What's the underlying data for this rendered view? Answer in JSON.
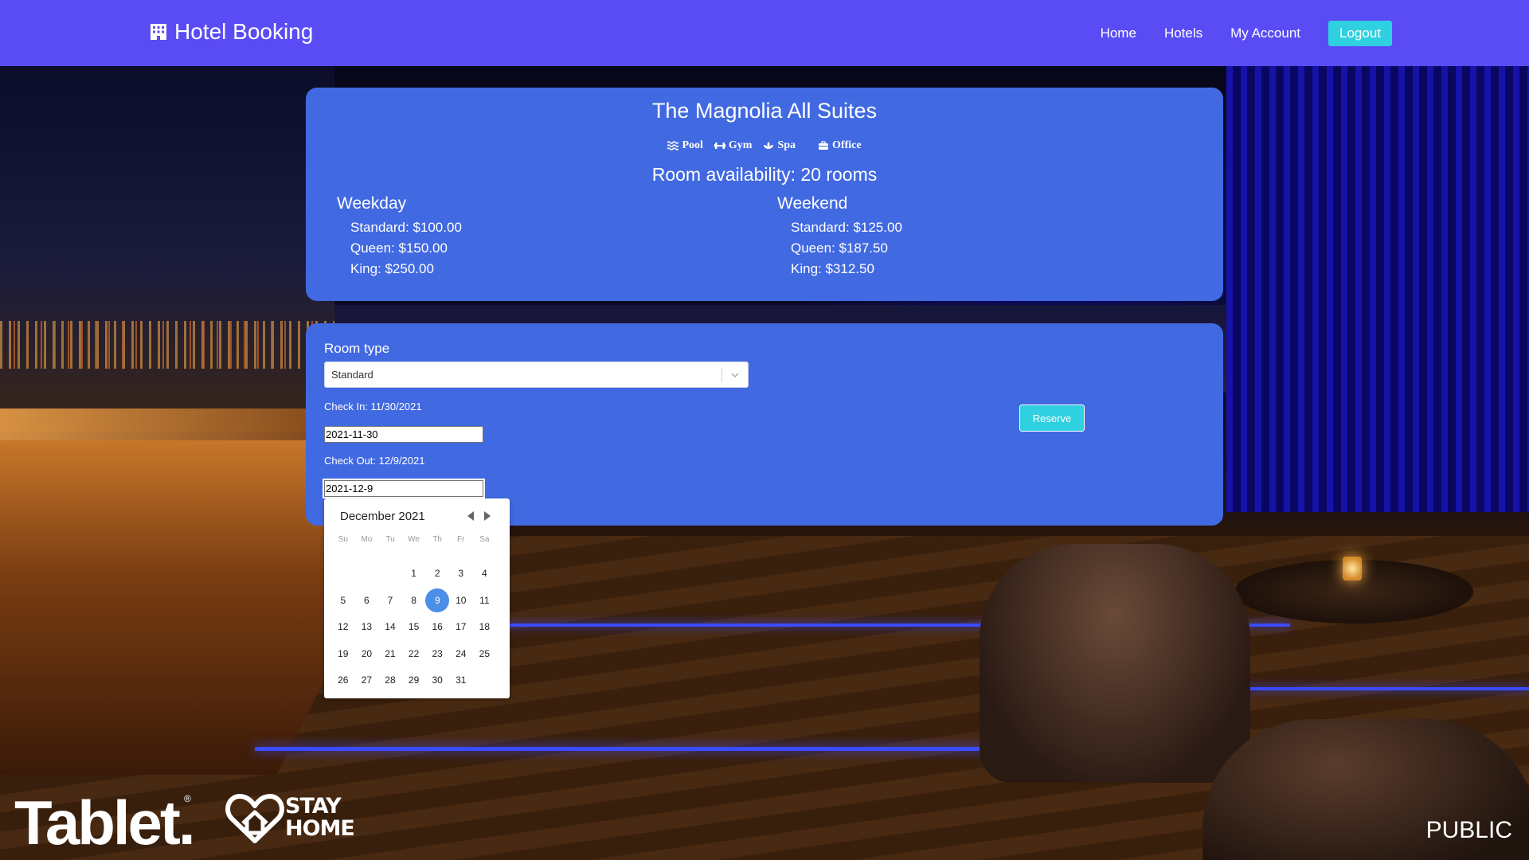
{
  "header": {
    "brand": "Hotel Booking",
    "nav": [
      "Home",
      "Hotels",
      "My Account"
    ],
    "logout": "Logout"
  },
  "hotel": {
    "name": "The Magnolia All Suites",
    "amenities": [
      "Pool",
      "Gym",
      "Spa",
      "Office"
    ],
    "availability": "Room availability: 20 rooms",
    "weekday": {
      "title": "Weekday",
      "rates": [
        "Standard: $100.00",
        "Queen: $150.00",
        "King: $250.00"
      ]
    },
    "weekend": {
      "title": "Weekend",
      "rates": [
        "Standard: $125.00",
        "Queen: $187.50",
        "King: $312.50"
      ]
    }
  },
  "form": {
    "room_type_label": "Room type",
    "room_type_value": "Standard",
    "check_in_label": "Check In: 11/30/2021",
    "check_in_value": "2021-11-30",
    "check_out_label": "Check Out: 12/9/2021",
    "check_out_value": "2021-12-9",
    "reserve_label": "Reserve"
  },
  "datepicker": {
    "month": "December 2021",
    "weekdays": [
      "Su",
      "Mo",
      "Tu",
      "We",
      "Th",
      "Fr",
      "Sa"
    ],
    "first_weekday_index": 3,
    "days_in_month": 31,
    "selected_day": 9,
    "selected_color": "#4a8ee8"
  },
  "watermarks": {
    "tablet": "Tablet.",
    "reg_mark": "®",
    "stay_home": "STAY\nHOME",
    "public": "PUBLIC"
  },
  "colors": {
    "header_bg": "#5a4cf5",
    "card_bg": "#4169e1",
    "accent_button": "#2fd0e0"
  }
}
